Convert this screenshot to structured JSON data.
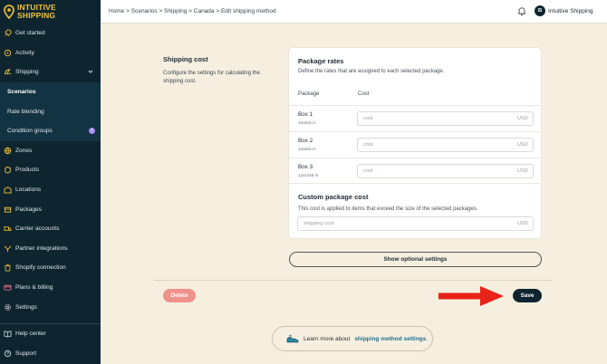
{
  "brand": {
    "line1": "INTUITIVE",
    "line2": "SHIPPING"
  },
  "sidebar": {
    "items": [
      {
        "label": "Get started",
        "icon": "rocket-icon"
      },
      {
        "label": "Activity",
        "icon": "activity-icon"
      },
      {
        "label": "Shipping",
        "icon": "shipping-icon"
      }
    ],
    "sub_items": [
      {
        "label": "Scenarios"
      },
      {
        "label": "Rate blending"
      },
      {
        "label": "Condition groups",
        "badge": "i"
      }
    ],
    "more_items": [
      {
        "label": "Zones",
        "icon": "zones-icon"
      },
      {
        "label": "Products",
        "icon": "products-icon"
      },
      {
        "label": "Locations",
        "icon": "locations-icon"
      },
      {
        "label": "Packages",
        "icon": "packages-icon"
      },
      {
        "label": "Carrier accounts",
        "icon": "carrier-icon"
      },
      {
        "label": "Partner integrations",
        "icon": "integrations-icon"
      },
      {
        "label": "Shopify connection",
        "icon": "shopify-icon"
      },
      {
        "label": "Plans & billing",
        "icon": "billing-icon"
      },
      {
        "label": "Settings",
        "icon": "gear-icon"
      }
    ],
    "bottom_items": [
      {
        "label": "Help center",
        "icon": "book-icon"
      },
      {
        "label": "Support",
        "icon": "support-icon"
      }
    ]
  },
  "header": {
    "breadcrumb": "Home > Scenarios > Shipping > Canada > Edit shipping method",
    "avatar_initials": "IS",
    "user_name": "Intuitive Shipping"
  },
  "section": {
    "title": "Shipping cost",
    "description": "Configure the settings for calculating the shipping cost."
  },
  "package_rates": {
    "title": "Package rates",
    "description": "Define the rates that are assigned to each selected package.",
    "col_package": "Package",
    "col_cost": "Cost",
    "rows": [
      {
        "name": "Box 1",
        "dims": "10x8x5 in",
        "placeholder": "cost",
        "unit": "USD"
      },
      {
        "name": "Box 2",
        "dims": "12x8x5 in",
        "placeholder": "cost",
        "unit": "USD"
      },
      {
        "name": "Box 3",
        "dims": "12x10x8 in",
        "placeholder": "cost",
        "unit": "USD"
      }
    ]
  },
  "custom_cost": {
    "title": "Custom package cost",
    "description": "This cost is applied to items that exceed the size of the selected packages.",
    "placeholder": "shipping cost",
    "unit": "USD"
  },
  "buttons": {
    "optional": "Show optional settings",
    "delete": "Delete",
    "save": "Save"
  },
  "learn": {
    "prefix": "Learn more about",
    "link": "shipping method settings",
    "suffix": "."
  },
  "colors": {
    "sidebar_bg": "#0e2530",
    "accent": "#f3c437",
    "page_bg": "#f6efe0",
    "delete": "#f0928c",
    "arrow": "#e8231a"
  }
}
